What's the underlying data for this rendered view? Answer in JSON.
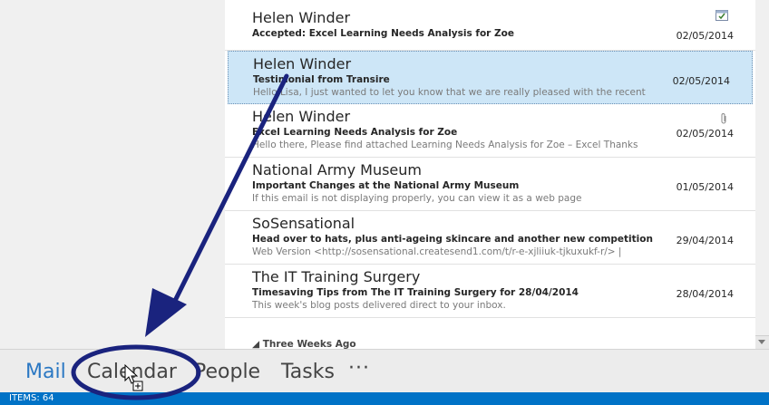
{
  "messages": [
    {
      "sender": "Helen Winder",
      "subject": "Accepted: Excel Learning Needs Analysis for Zoe",
      "preview": "",
      "date": "02/05/2014",
      "icon": "calendar-accepted-icon"
    },
    {
      "sender": "Helen Winder",
      "subject": "Testimonial from Transire",
      "preview": "Hello Lisa,  I just wanted to let you know that we are really pleased with the recent",
      "date": "02/05/2014",
      "icon": ""
    },
    {
      "sender": "Helen Winder",
      "subject": "Excel Learning Needs Analysis for Zoe",
      "preview": "Hello there,  Please find attached Learning Needs Analysis for Zoe – Excel  Thanks",
      "date": "02/05/2014",
      "icon": "paperclip-icon"
    },
    {
      "sender": "National Army Museum",
      "subject": "Important Changes at the National Army Museum",
      "preview": "If this email is not displaying properly, you can view it as a web page",
      "date": "01/05/2014",
      "icon": ""
    },
    {
      "sender": "SoSensational",
      "subject": "Head over to hats, plus anti-ageing skincare and another new competition",
      "preview": "Web Version <http://sosensational.createsend1.com/t/r-e-xjliiuk-tjkuxukf-r/>   |",
      "date": "29/04/2014",
      "icon": ""
    },
    {
      "sender": "The IT Training Surgery",
      "subject": "Timesaving Tips from  The IT Training Surgery for 28/04/2014",
      "preview": "This week's blog posts delivered direct to your inbox.",
      "date": "28/04/2014",
      "icon": ""
    }
  ],
  "group_header": "◢ Three Weeks Ago",
  "nav": {
    "mail": "Mail",
    "calendar": "Calendar",
    "people": "People",
    "tasks": "Tasks",
    "more": "···"
  },
  "status": {
    "items": "ITEMS: 64"
  },
  "colors": {
    "accent": "#2b78c3",
    "status_bar": "#0072c6",
    "selected_row": "#cde6f7",
    "annotation": "#1a237e"
  }
}
